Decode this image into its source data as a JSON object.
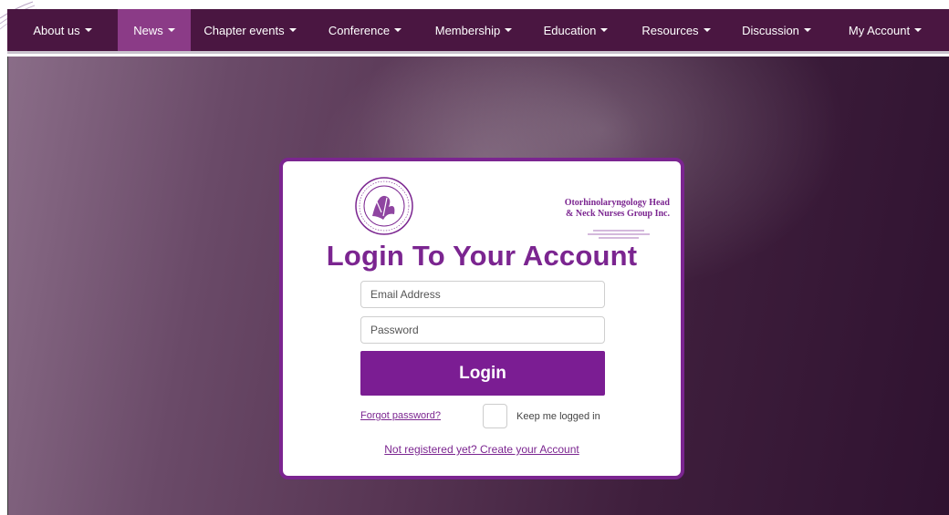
{
  "nav": {
    "items": [
      {
        "label": "About us",
        "active": false
      },
      {
        "label": "News",
        "active": true
      },
      {
        "label": "Chapter events",
        "active": false
      },
      {
        "label": "Conference",
        "active": false
      },
      {
        "label": "Membership",
        "active": false
      },
      {
        "label": "Education",
        "active": false
      },
      {
        "label": "Resources",
        "active": false
      },
      {
        "label": "Discussion",
        "active": false
      },
      {
        "label": "My Account",
        "active": false
      }
    ],
    "icon": "caret-down-icon"
  },
  "login": {
    "logo": {
      "org_name": "Otorhinolaryngology Head\n& Neck Nurses Group Inc.",
      "seal_icon": "seal-logo-icon"
    },
    "title": "Login To Your Account",
    "email_placeholder": "Email Address",
    "password_placeholder": "Password",
    "login_label": "Login",
    "forgot_label": "Forgot password?",
    "remember_label": "Keep me logged in",
    "register_label": "Not registered yet? Create your Account"
  },
  "colors": {
    "nav_bg": "#4a1641",
    "nav_active": "#8b3b87",
    "accent": "#7b2590",
    "button": "#7b1d93"
  }
}
